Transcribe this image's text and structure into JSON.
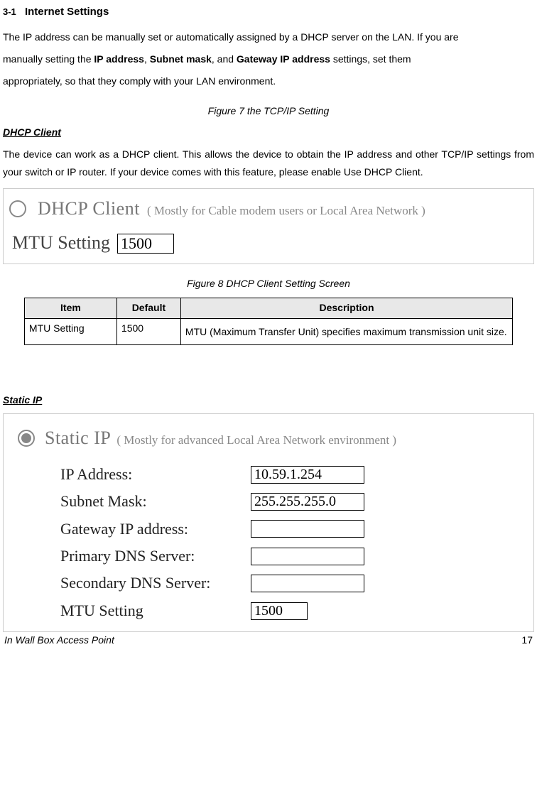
{
  "section": {
    "number": "3-1",
    "title": "Internet Settings"
  },
  "intro": {
    "line1_pre": "The IP address can be manually set or automatically assigned by a DHCP server on the LAN. If you are",
    "line2_pre": "manually setting the ",
    "bold_ip": "IP address",
    "comma1": ", ",
    "bold_subnet": "Subnet mask",
    "comma2": ", and ",
    "bold_gateway": "Gateway IP address",
    "line2_post": " settings, set them",
    "line3": "appropriately, so that they comply with your LAN environment."
  },
  "figure7_caption": "Figure 7 the TCP/IP Setting",
  "dhcp": {
    "heading": "DHCP Client",
    "body": "The device can work as a DHCP client. This allows the device to obtain the IP address and other TCP/IP settings from your switch or IP router. If your device comes with this feature, please enable Use DHCP Client.",
    "screenshot": {
      "title": "DHCP Client",
      "hint": "( Mostly for Cable modem users or Local Area Network )",
      "mtu_label": "MTU Setting",
      "mtu_value": "1500"
    },
    "figure8_caption": "Figure 8 DHCP Client Setting Screen",
    "table": {
      "headers": {
        "item": "Item",
        "default": "Default",
        "description": "Description"
      },
      "rows": [
        {
          "item": "MTU Setting",
          "default": "1500",
          "description": "MTU (Maximum Transfer Unit) specifies maximum transmission unit size."
        }
      ]
    }
  },
  "static": {
    "heading": "Static IP",
    "screenshot": {
      "title": "Static IP",
      "hint": "( Mostly for advanced Local Area Network environment )",
      "fields": {
        "ip_label": "IP Address:",
        "ip_value": "10.59.1.254",
        "subnet_label": "Subnet Mask:",
        "subnet_value": "255.255.255.0",
        "gateway_label": "Gateway IP address:",
        "gateway_value": "",
        "pdns_label": "Primary DNS Server:",
        "pdns_value": "",
        "sdns_label": "Secondary DNS Server:",
        "sdns_value": "",
        "mtu_label": "MTU Setting",
        "mtu_value": "1500"
      }
    }
  },
  "footer": {
    "doc_title": "In Wall Box Access Point",
    "page_number": "17"
  }
}
